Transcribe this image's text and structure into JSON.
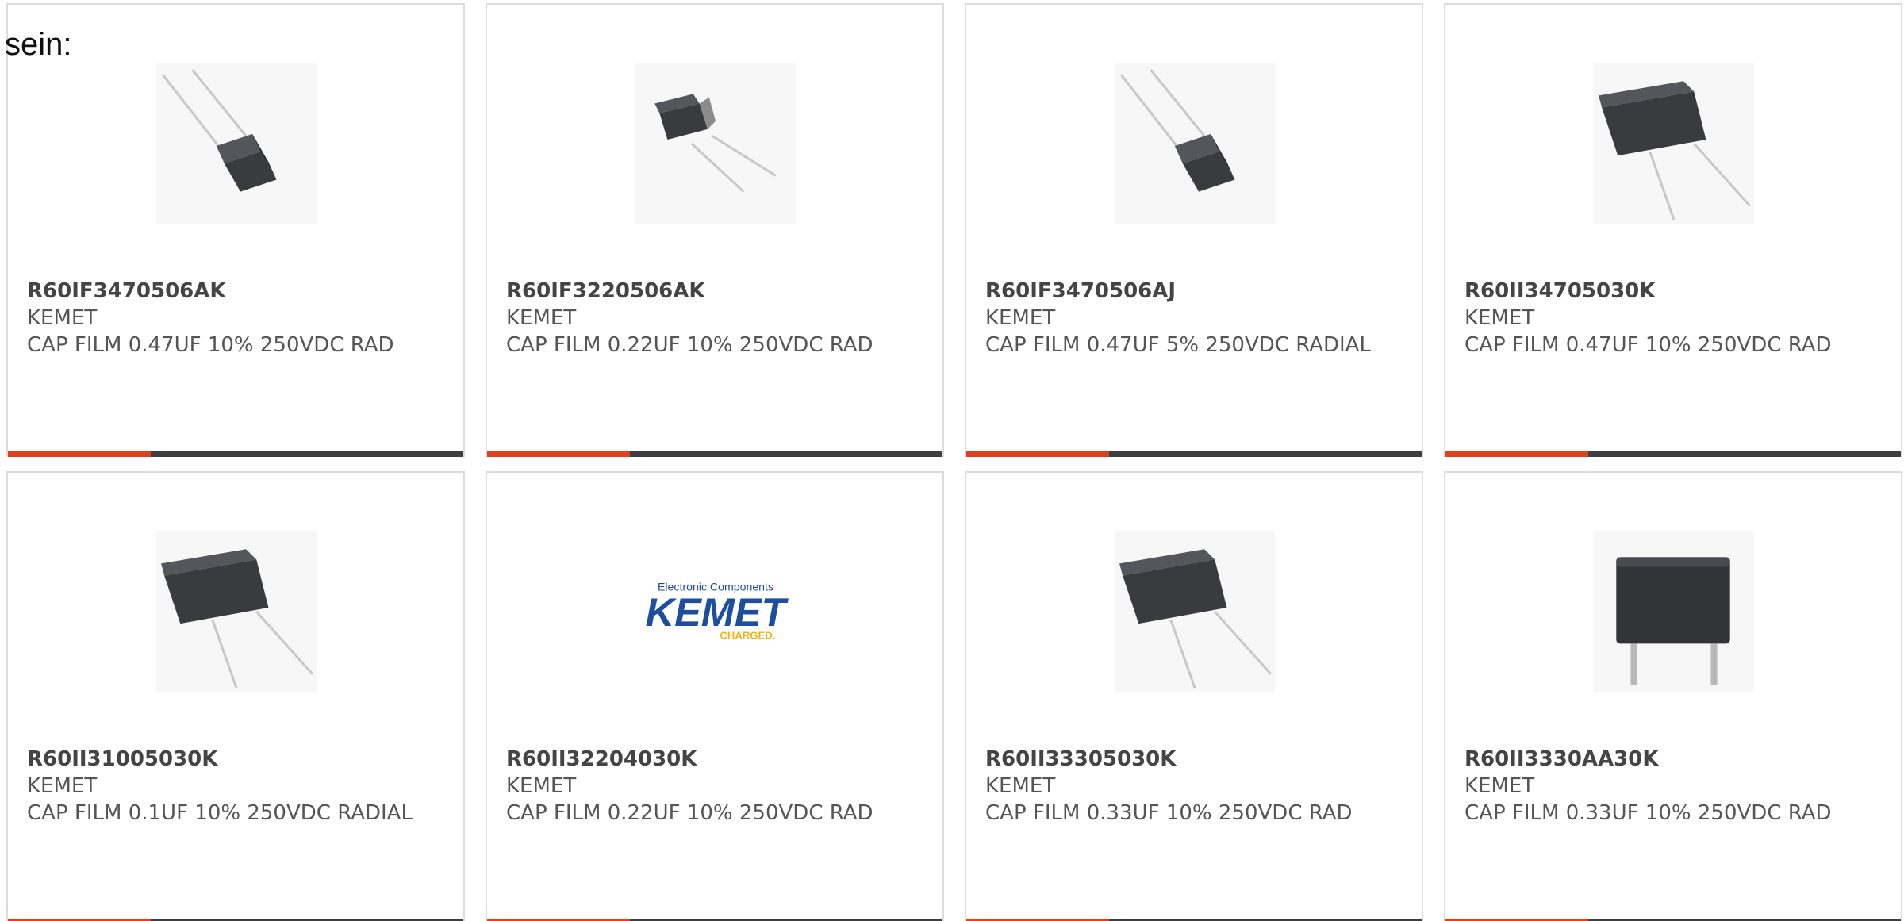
{
  "intro_text": "sein:",
  "colors": {
    "accent": "#e2401b",
    "bar": "#3f3f3f",
    "card_border": "#dcdcdc",
    "text": "#555555",
    "kemet_blue": "#1d4f9c",
    "kemet_yellow": "#f0b51d"
  },
  "products": [
    {
      "part": "R60IF3470506AK",
      "manufacturer": "KEMET",
      "description": "CAP FILM 0.47UF 10% 250VDC RAD",
      "image": "film-capacitor-leads-up-left"
    },
    {
      "part": "R60IF3220506AK",
      "manufacturer": "KEMET",
      "description": "CAP FILM 0.22UF 10% 250VDC RAD",
      "image": "film-capacitor-small-leads-down-right"
    },
    {
      "part": "R60IF3470506AJ",
      "manufacturer": "KEMET",
      "description": "CAP FILM 0.47UF 5% 250VDC RADIAL",
      "image": "film-capacitor-leads-up-left"
    },
    {
      "part": "R60II34705030K",
      "manufacturer": "KEMET",
      "description": "CAP FILM 0.47UF 10% 250VDC RAD",
      "image": "film-capacitor-leads-down-right"
    },
    {
      "part": "R60II31005030K",
      "manufacturer": "KEMET",
      "description": "CAP FILM 0.1UF 10% 250VDC RADIAL",
      "image": "film-capacitor-leads-down-right"
    },
    {
      "part": "R60II32204030K",
      "manufacturer": "KEMET",
      "description": "CAP FILM 0.22UF 10% 250VDC RAD",
      "image": "kemet-logo",
      "logo": {
        "tagline": "Electronic Components",
        "brand": "KEMET",
        "slogan": "CHARGED."
      }
    },
    {
      "part": "R60II33305030K",
      "manufacturer": "KEMET",
      "description": "CAP FILM 0.33UF 10% 250VDC RAD",
      "image": "film-capacitor-leads-down-right"
    },
    {
      "part": "R60II3330AA30K",
      "manufacturer": "KEMET",
      "description": "CAP FILM 0.33UF 10% 250VDC RAD",
      "image": "film-capacitor-front-leads-down"
    }
  ]
}
